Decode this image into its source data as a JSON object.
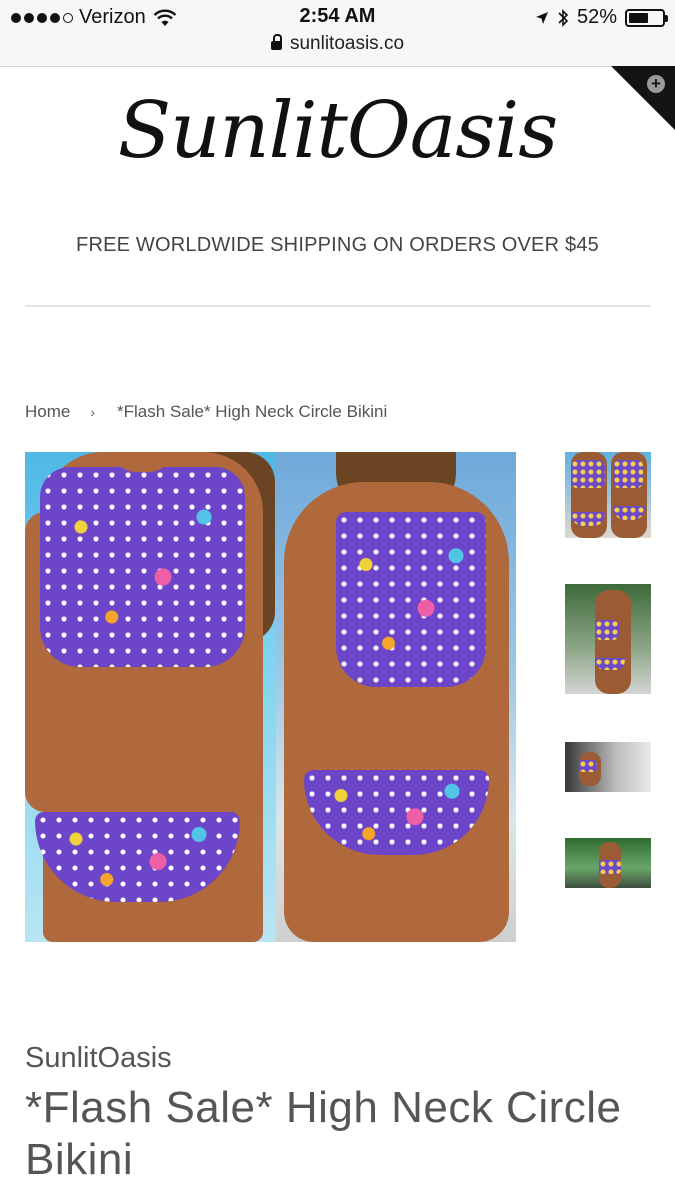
{
  "status_bar": {
    "carrier": "Verizon",
    "time": "2:54 AM",
    "battery": "52%",
    "battery_level": 0.52,
    "url": "sunlitoasis.co"
  },
  "header": {
    "logo_text": "SunlitOasis",
    "promo": "FREE WORLDWIDE SHIPPING ON ORDERS OVER $45"
  },
  "breadcrumb": {
    "home": "Home",
    "separator": "›",
    "current": "*Flash Sale* High Neck Circle Bikini"
  },
  "gallery": {
    "thumbnails": [
      "thumb-1",
      "thumb-2",
      "thumb-3",
      "thumb-4"
    ],
    "selected": 0
  },
  "product": {
    "vendor": "SunlitOasis",
    "title": "*Flash Sale* High Neck Circle Bikini"
  },
  "colors": {
    "accent": "#141414",
    "text": "#555555",
    "divider": "#e4e4e4"
  }
}
